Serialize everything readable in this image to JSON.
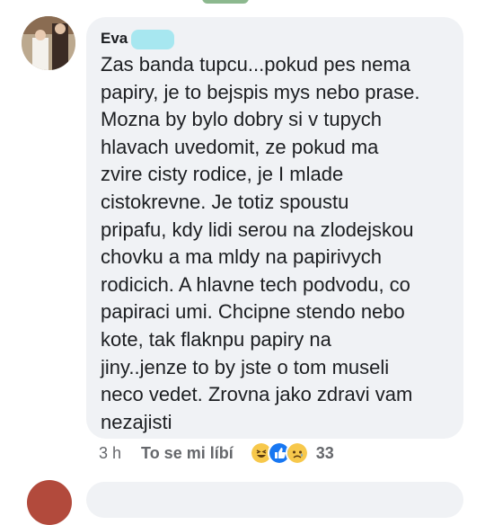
{
  "comment": {
    "author": "Eva",
    "text": "Zas banda tupcu...pokud pes nema\npapiry, je to bejspis mys nebo prase.\nMozna by bylo dobry si v tupych\nhlavach uvedomit, ze pokud ma\nzvire cisty rodice, je I mlade\ncistokrevne. Je totiz spoustu\npripafu, kdy lidi serou na zlodejskou\nchovku a ma mldy na papirivych\nrodicich. A hlavne tech podvodu, co\npapiraci umi. Chcipne stendo nebo\nkote, tak flaknpu papiry na\njiny..jenze to by jste o tom museli\nneco vedet. Zrovna jako zdravi vam\nnezajisti",
    "time": "3 h",
    "like_label": "To se mi líbí",
    "reaction_count": "33",
    "reaction_icons": [
      "haha-icon",
      "like-icon",
      "sad-icon"
    ]
  },
  "colors": {
    "bubble": "#f0f2f5",
    "text": "#1c1e21",
    "meta": "#65676b",
    "like_blue": "#1877f2",
    "emoji_yellow": "#f7c84b"
  }
}
